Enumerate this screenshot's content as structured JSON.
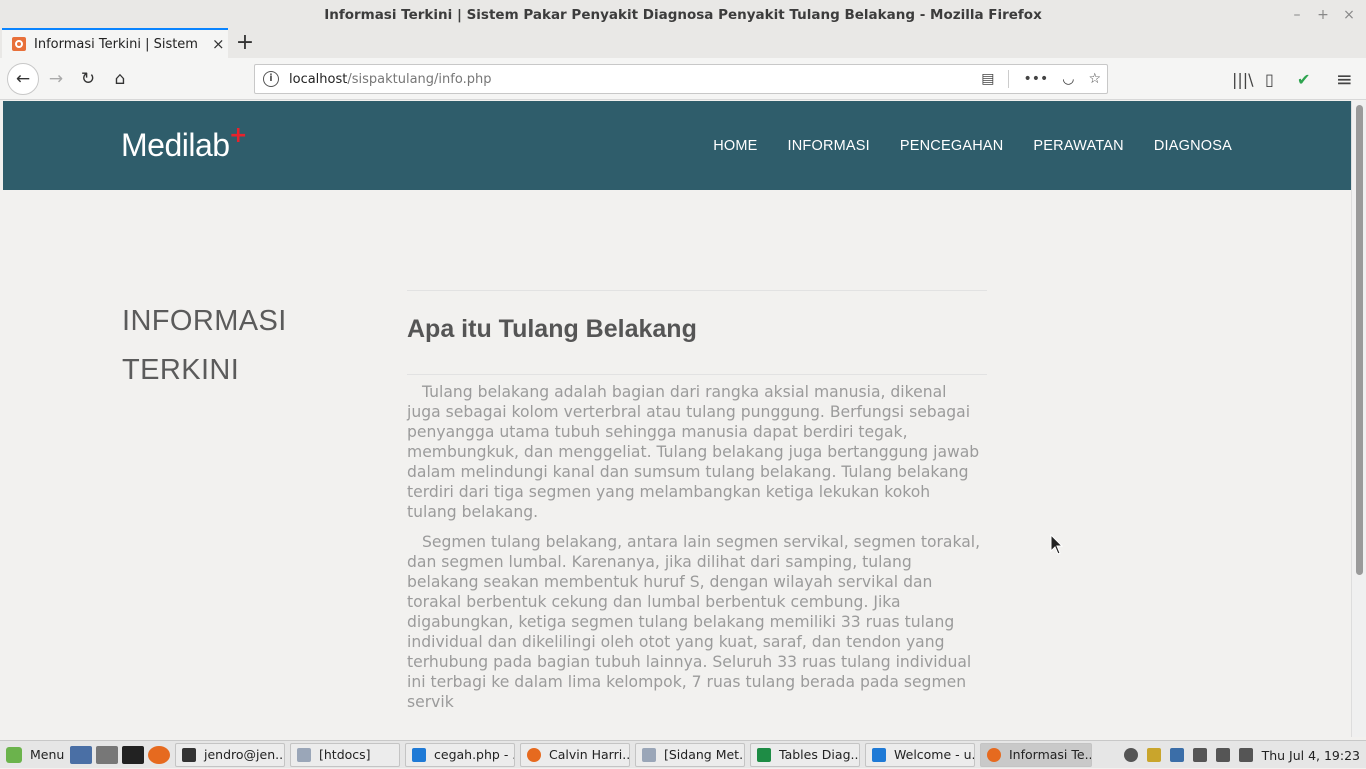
{
  "window": {
    "title": "Informasi Terkini | Sistem Pakar Penyakit Diagnosa Penyakit Tulang Belakang - Mozilla Firefox",
    "controls": [
      "–",
      "+",
      "×"
    ]
  },
  "tabs": [
    {
      "label": "Informasi Terkini | Sistem Pakar",
      "close": "×",
      "active": true
    }
  ],
  "new_tab": "+",
  "nav": {
    "back": "←",
    "forward": "→",
    "reload": "↻",
    "home": "⌂"
  },
  "url": {
    "info": "i",
    "host": "localhost",
    "path": "/sispaktulang/info.php",
    "reader": "▤",
    "more": "•••",
    "pocket": "◡",
    "bookmark": "☆"
  },
  "toolbar_right": {
    "library": "|||\\",
    "sidebar": "▯",
    "shield": "✔",
    "menu": "≡"
  },
  "site": {
    "logo": "Medilab",
    "logo_plus": "+",
    "menu": [
      "HOME",
      "INFORMASI",
      "PENCEGAHAN",
      "PERAWATAN",
      "DIAGNOSA"
    ],
    "side_title": "INFORMASI TERKINI",
    "article_title": "Apa itu Tulang Belakang",
    "paragraphs": [
      "Tulang belakang adalah bagian dari rangka aksial manusia, dikenal juga sebagai kolom verterbral atau tulang punggung. Berfungsi sebagai penyangga utama tubuh sehingga manusia dapat berdiri tegak, membungkuk, dan menggeliat. Tulang belakang juga bertanggung jawab dalam melindungi kanal dan sumsum tulang belakang. Tulang belakang terdiri dari tiga segmen yang melambangkan ketiga lekukan kokoh tulang belakang.",
      "Segmen tulang belakang, antara lain segmen servikal, segmen torakal, dan segmen lumbal. Karenanya, jika dilihat dari samping, tulang belakang seakan membentuk huruf S, dengan wilayah servikal dan torakal berbentuk cekung dan lumbal berbentuk cembung. Jika digabungkan, ketiga segmen tulang belakang memiliki 33 ruas tulang individual dan dikelilingi oleh otot yang kuat, saraf, dan tendon yang terhubung pada bagian tubuh lainnya. Seluruh 33 ruas tulang individual ini terbagi ke dalam lima kelompok, 7 ruas tulang berada pada segmen servik"
    ]
  },
  "taskbar": {
    "menu_label": "Menu",
    "items": [
      {
        "label": "jendro@jen...",
        "icon": "terminal-icon",
        "color": "#333333",
        "active": false
      },
      {
        "label": "[htdocs]",
        "icon": "folder-icon",
        "color": "#9aa6b8",
        "active": false
      },
      {
        "label": "cegah.php - ...",
        "icon": "vscode-icon",
        "color": "#1f7ad6",
        "active": false
      },
      {
        "label": "Calvin Harri...",
        "icon": "firefox-icon",
        "color": "#e66a1f",
        "active": false
      },
      {
        "label": "[Sidang Met...",
        "icon": "folder-icon",
        "color": "#9aa6b8",
        "active": false
      },
      {
        "label": "Tables Diag...",
        "icon": "spreadsheet-icon",
        "color": "#1e8c45",
        "active": false
      },
      {
        "label": "Welcome - u...",
        "icon": "vscode-icon",
        "color": "#1f7ad6",
        "active": false
      },
      {
        "label": "Informasi Te...",
        "icon": "firefox-icon",
        "color": "#e66a1f",
        "active": true
      }
    ],
    "clock": "Thu Jul  4, 19:23"
  }
}
